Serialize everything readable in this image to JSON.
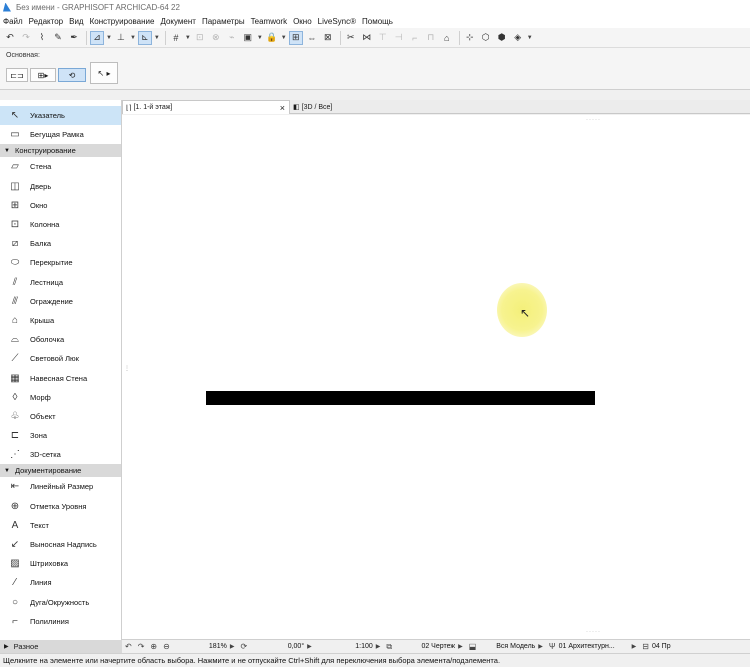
{
  "window": {
    "title": "Без имени - GRAPHISOFT ARCHICAD-64 22"
  },
  "menu": [
    "Файл",
    "Редактор",
    "Вид",
    "Конструирование",
    "Документ",
    "Параметры",
    "Teamwork",
    "Окно",
    "LiveSync®",
    "Помощь"
  ],
  "infobox": {
    "label": "Основная:"
  },
  "tabs": [
    {
      "label": "[1. 1-й этаж]",
      "active": true
    },
    {
      "label": "[3D / Все]",
      "active": false
    }
  ],
  "tabs_close": "×",
  "toolbox": {
    "top_items": [
      {
        "label": "Указатель",
        "icon": "arrow-pointer-icon",
        "selected": true
      },
      {
        "label": "Бегущая Рамка",
        "icon": "marquee-icon",
        "selected": false
      }
    ],
    "sections": [
      {
        "title": "Конструирование",
        "items": [
          {
            "label": "Стена",
            "icon": "wall-icon"
          },
          {
            "label": "Дверь",
            "icon": "door-icon"
          },
          {
            "label": "Окно",
            "icon": "window-icon"
          },
          {
            "label": "Колонна",
            "icon": "column-icon"
          },
          {
            "label": "Балка",
            "icon": "beam-icon"
          },
          {
            "label": "Перекрытие",
            "icon": "slab-icon"
          },
          {
            "label": "Лестница",
            "icon": "stair-icon"
          },
          {
            "label": "Ограждение",
            "icon": "railing-icon"
          },
          {
            "label": "Крыша",
            "icon": "roof-icon"
          },
          {
            "label": "Оболочка",
            "icon": "shell-icon"
          },
          {
            "label": "Световой Люк",
            "icon": "skylight-icon"
          },
          {
            "label": "Навесная Стена",
            "icon": "curtain-wall-icon"
          },
          {
            "label": "Морф",
            "icon": "morph-icon"
          },
          {
            "label": "Объект",
            "icon": "object-icon"
          },
          {
            "label": "Зона",
            "icon": "zone-icon"
          },
          {
            "label": "3D-сетка",
            "icon": "mesh-icon"
          }
        ]
      },
      {
        "title": "Документирование",
        "items": [
          {
            "label": "Линейный Размер",
            "icon": "dimension-icon"
          },
          {
            "label": "Отметка Уровня",
            "icon": "level-dimension-icon"
          },
          {
            "label": "Текст",
            "icon": "text-icon"
          },
          {
            "label": "Выносная Надпись",
            "icon": "label-icon"
          },
          {
            "label": "Штриховка",
            "icon": "fill-icon"
          },
          {
            "label": "Линия",
            "icon": "line-icon"
          },
          {
            "label": "Дуга/Окружность",
            "icon": "arc-icon"
          },
          {
            "label": "Полилиния",
            "icon": "polyline-icon"
          }
        ]
      }
    ],
    "bottom_section": "Разное"
  },
  "navbar": {
    "zoom": "181%",
    "angle": "0,00°",
    "scale": "1:100",
    "layer_combo": "02 Чертеж",
    "model_view": "Вся Модель",
    "pen_set": "01 Архитектурн...",
    "extra": "04 Пр"
  },
  "status": {
    "text": "Щелкните на элементе или начертите область выбора. Нажмите и не отпускайте Ctrl+Shift для переключения выбора элемента/подэлемента."
  },
  "colors": {
    "selection": "#cce4f7",
    "wall": "#000000",
    "highlight": "#f4f07a"
  }
}
